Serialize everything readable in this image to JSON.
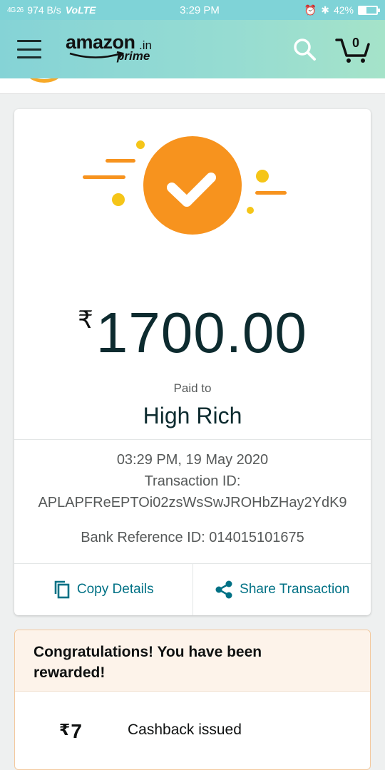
{
  "status_bar": {
    "signal": "4G 26",
    "speed": "974 B/s",
    "network": "VoLTE",
    "time": "3:29 PM",
    "battery": "42%",
    "battery_level": 0.42
  },
  "header": {
    "logo_text": "amazon",
    "logo_suffix": ".in",
    "logo_prime": "prime",
    "cart_count": "0"
  },
  "payment": {
    "currency_symbol": "₹",
    "amount": "1700.00",
    "paid_to_label": "Paid to",
    "payee": "High Rich",
    "datetime": "03:29 PM, 19 May 2020",
    "transaction_id_label": "Transaction ID:",
    "transaction_id": "APLAPFReEPTOi02zsWsSwJROHbZHay2YdK9",
    "bank_reference": "Bank Reference ID: 014015101675"
  },
  "actions": {
    "copy_label": "Copy Details",
    "share_label": "Share Transaction"
  },
  "reward": {
    "title": "Congratulations! You have been rewarded!",
    "currency_symbol": "₹",
    "amount": "7",
    "description": "Cashback issued"
  },
  "colors": {
    "header": "#85d3d6",
    "accent_orange": "#f7931e",
    "accent_yellow": "#f5c518",
    "link": "#007185",
    "amount_text": "#0d2b2f"
  }
}
